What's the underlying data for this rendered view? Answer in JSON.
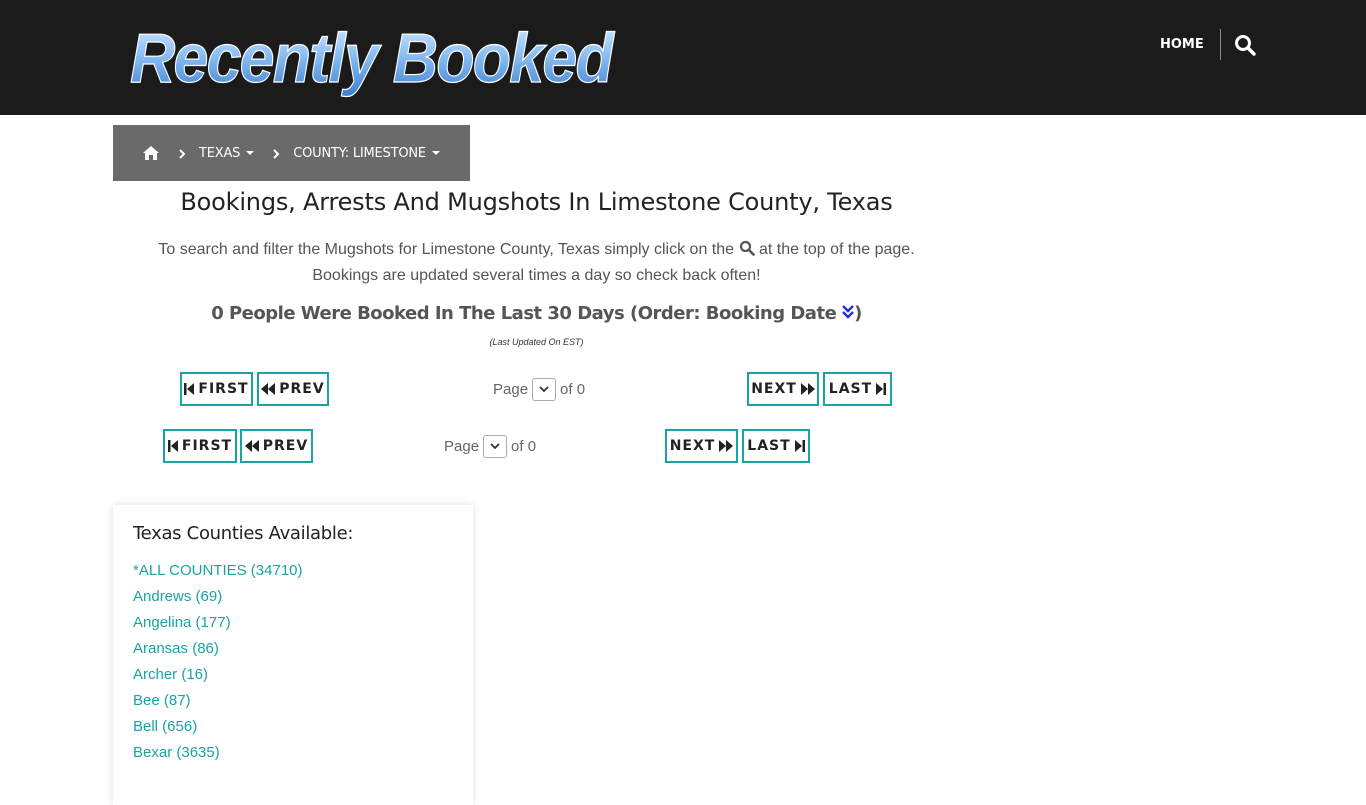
{
  "header": {
    "logo_text": "Recently Booked",
    "nav_home": "HOME",
    "search_icon": "search-icon"
  },
  "breadcrumb": {
    "home_icon": "home-icon",
    "state": "TEXAS",
    "county": "COUNTY: LIMESTONE"
  },
  "main": {
    "title": "Bookings, Arrests And Mugshots In Limestone County, Texas",
    "intro_part1": "To search and filter the Mugshots for Limestone County, Texas simply click on the",
    "intro_part2": "at the top of the page.",
    "intro_line2": "Bookings are updated several times a day so check back often!",
    "count_text": "0 People Were Booked In The Last 30 Days (Order: Booking Date",
    "count_close": ")",
    "updated_text": "(Last Updated On EST)"
  },
  "pagination": {
    "first": "FIRST",
    "prev": "PREV",
    "next": "NEXT",
    "last": "LAST",
    "page_label": "Page",
    "of_label": "of 0"
  },
  "counties": {
    "heading": "Texas Counties Available:",
    "items": [
      {
        "label": "*ALL COUNTIES (34710)"
      },
      {
        "label": "Andrews (69)"
      },
      {
        "label": "Angelina (177)"
      },
      {
        "label": "Aransas (86)"
      },
      {
        "label": "Archer (16)"
      },
      {
        "label": "Bee (87)"
      },
      {
        "label": "Bell (656)"
      },
      {
        "label": "Bexar (3635)"
      }
    ]
  },
  "colors": {
    "header_bg": "#1b1b1b",
    "breadcrumb_bg": "#6a6a6a",
    "accent_teal": "#1aa3a3",
    "logo_blue": "#7fb4ee"
  }
}
